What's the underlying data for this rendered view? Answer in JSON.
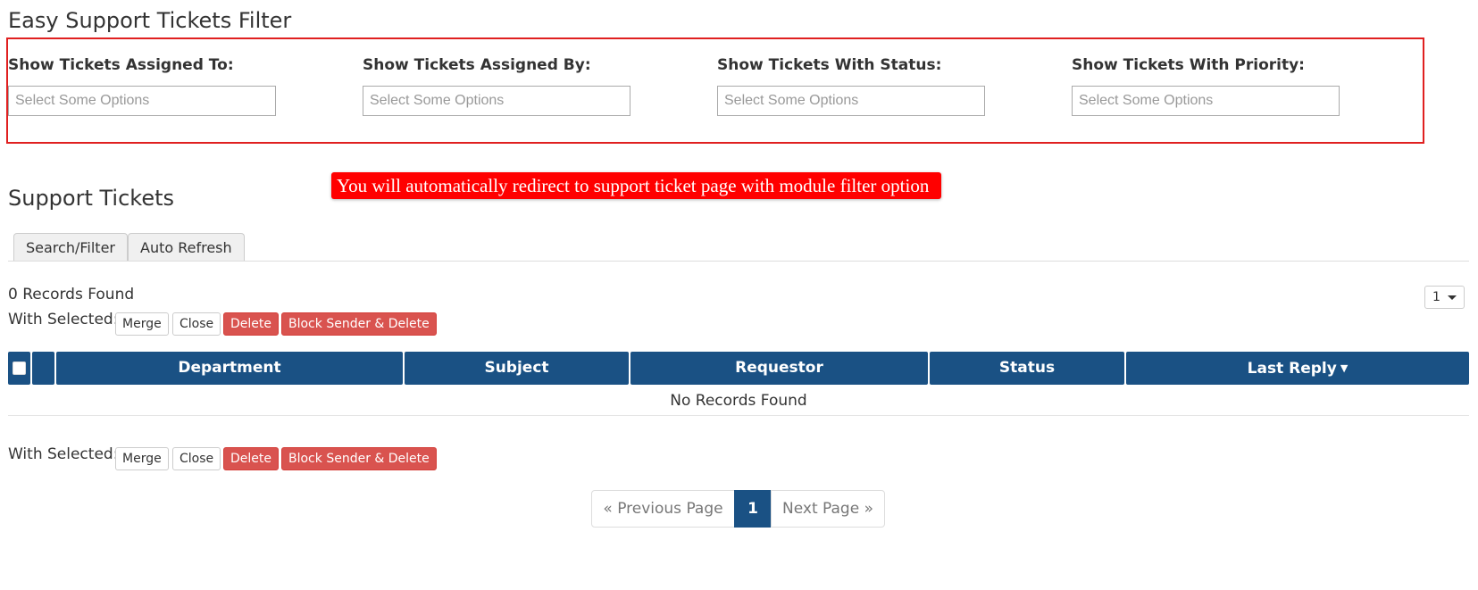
{
  "filter": {
    "title": "Easy Support Tickets Filter",
    "fields": [
      {
        "label": "Show Tickets Assigned To:",
        "placeholder": "Select Some Options"
      },
      {
        "label": "Show Tickets Assigned By:",
        "placeholder": "Select Some Options"
      },
      {
        "label": "Show Tickets With Status:",
        "placeholder": "Select Some Options"
      },
      {
        "label": "Show Tickets With Priority:",
        "placeholder": "Select Some Options"
      }
    ],
    "highlight_color": "#e02020"
  },
  "notice": {
    "text": "You will automatically redirect to support ticket page with module filter option",
    "color": "#ff0000"
  },
  "tickets": {
    "title": "Support Tickets",
    "tabs": [
      {
        "label": "Search/Filter"
      },
      {
        "label": "Auto Refresh"
      }
    ],
    "records_found": "0 Records Found",
    "page_select": "1",
    "with_selected_label": "With Selected:",
    "actions": {
      "merge": "Merge",
      "close": "Close",
      "delete": "Delete",
      "block_delete": "Block Sender & Delete"
    },
    "columns": {
      "department": "Department",
      "subject": "Subject",
      "requestor": "Requestor",
      "status": "Status",
      "last_reply": "Last Reply"
    },
    "sort_icon": "sort-desc-icon",
    "empty_text": "No Records Found",
    "header_color": "#1a5184"
  },
  "pagination": {
    "prev": "« Previous Page",
    "current": "1",
    "next": "Next Page »"
  }
}
